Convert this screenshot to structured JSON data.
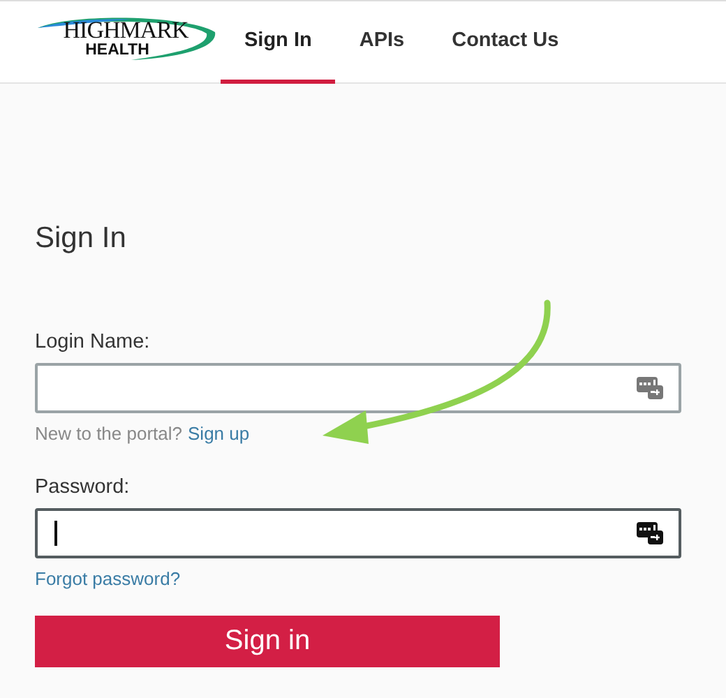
{
  "header": {
    "logo": {
      "line_1": "HIGHMARK",
      "line_2": "HEALTH"
    },
    "tabs": [
      {
        "label": "Sign In",
        "selected": true
      },
      {
        "label": "APIs",
        "selected": false
      },
      {
        "label": "Contact Us",
        "selected": false
      }
    ]
  },
  "form": {
    "title": "Sign In",
    "fields": [
      {
        "label": "Login Name:",
        "focused": false,
        "hint": "New to the portal?",
        "link": "Sign up"
      },
      {
        "label": "Password:",
        "focused": true,
        "link": "Forgot password?"
      }
    ],
    "button": "Sign in"
  },
  "annotation": {
    "kind": "arrow",
    "color": "#8fd14f"
  }
}
